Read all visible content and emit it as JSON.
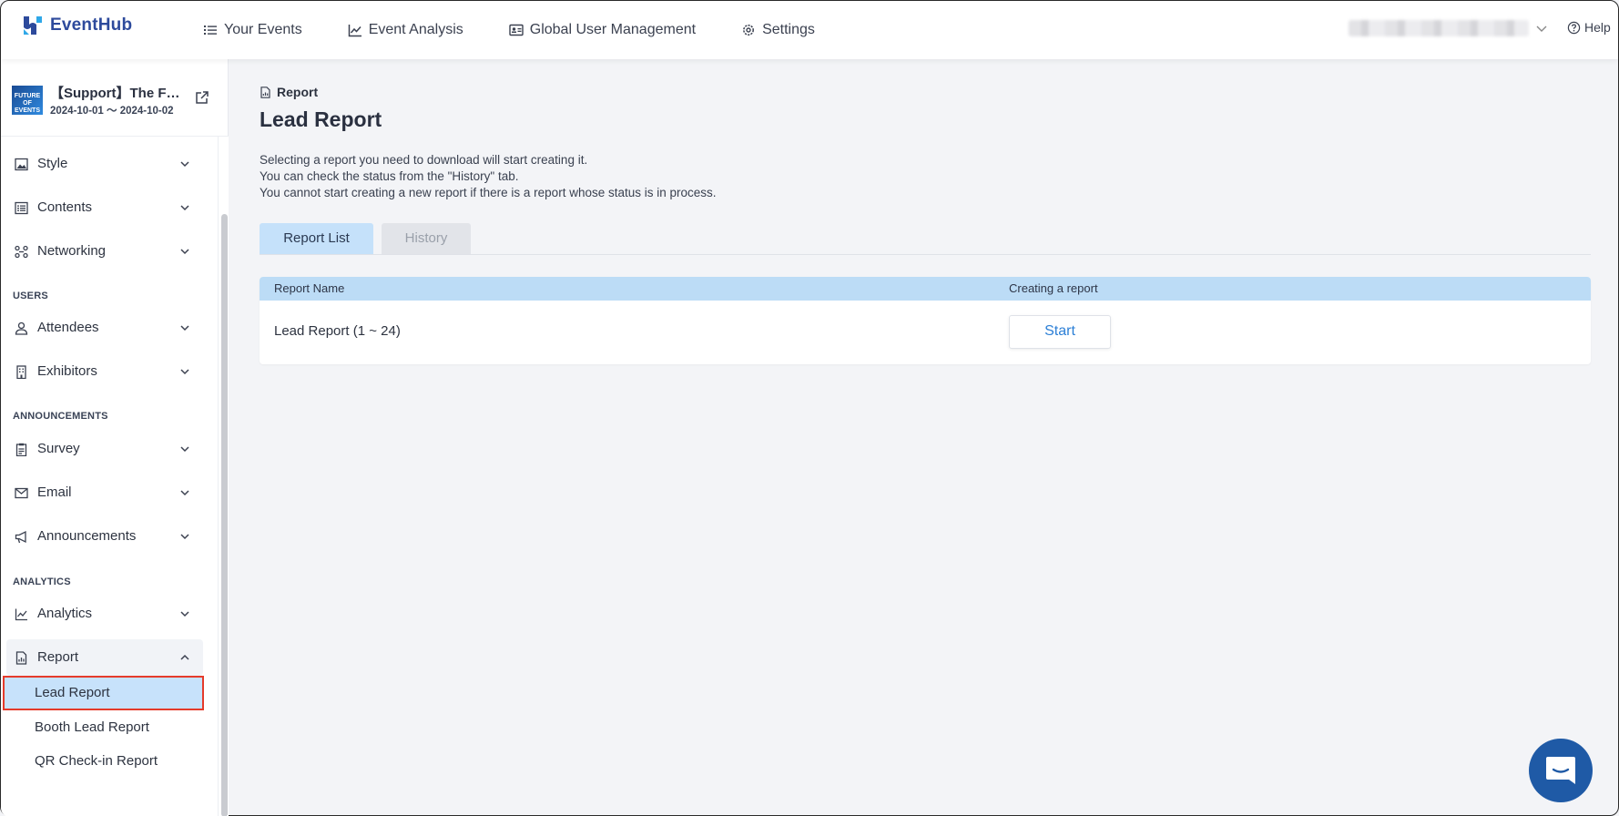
{
  "app": {
    "name": "EventHub"
  },
  "topnav": {
    "items": [
      {
        "label": "Your Events",
        "icon": "list-icon"
      },
      {
        "label": "Event Analysis",
        "icon": "chart-line-icon"
      },
      {
        "label": "Global User Management",
        "icon": "id-card-icon"
      },
      {
        "label": "Settings",
        "icon": "gear-icon"
      }
    ],
    "help_label": "Help"
  },
  "event": {
    "title": "【Support】The F…",
    "dates": "2024-10-01 ～ 2024-10-02",
    "thumb_text": "FUTURE OF EVENTS"
  },
  "sidebar": {
    "items": [
      {
        "label": "Style",
        "icon": "image-icon"
      },
      {
        "label": "Contents",
        "icon": "list-alt-icon"
      },
      {
        "label": "Networking",
        "icon": "network-icon"
      },
      {
        "label": "Attendees",
        "icon": "user-icon"
      },
      {
        "label": "Exhibitors",
        "icon": "building-icon"
      },
      {
        "label": "Survey",
        "icon": "clipboard-icon"
      },
      {
        "label": "Email",
        "icon": "envelope-icon"
      },
      {
        "label": "Announcements",
        "icon": "megaphone-icon"
      },
      {
        "label": "Analytics",
        "icon": "chart-line-icon"
      },
      {
        "label": "Report",
        "icon": "file-icon"
      }
    ],
    "sections": {
      "users": "USERS",
      "announcements": "ANNOUNCEMENTS",
      "analytics": "ANALYTICS"
    },
    "report_sub": [
      {
        "label": "Lead Report",
        "active": true
      },
      {
        "label": "Booth Lead Report",
        "active": false
      },
      {
        "label": "QR Check-in Report",
        "active": false
      }
    ]
  },
  "main": {
    "breadcrumb": "Report",
    "title": "Lead Report",
    "description": [
      "Selecting a report you need to download will start creating it.",
      "You can check the status from the \"History\" tab.",
      "You cannot start creating a new report if there is a report whose status is in process."
    ],
    "tabs": [
      {
        "label": "Report List",
        "active": true
      },
      {
        "label": "History",
        "active": false
      }
    ],
    "table": {
      "headers": [
        "Report Name",
        "Creating a report"
      ],
      "rows": [
        {
          "name": "Lead Report (1 ~ 24)",
          "action": "Start"
        }
      ]
    }
  },
  "colors": {
    "brand": "#2d4a9c",
    "accent": "#2c7fd6",
    "active_bg": "#c7e2fb",
    "highlight_border": "#e53b2b",
    "chat": "#1f5aa6"
  }
}
